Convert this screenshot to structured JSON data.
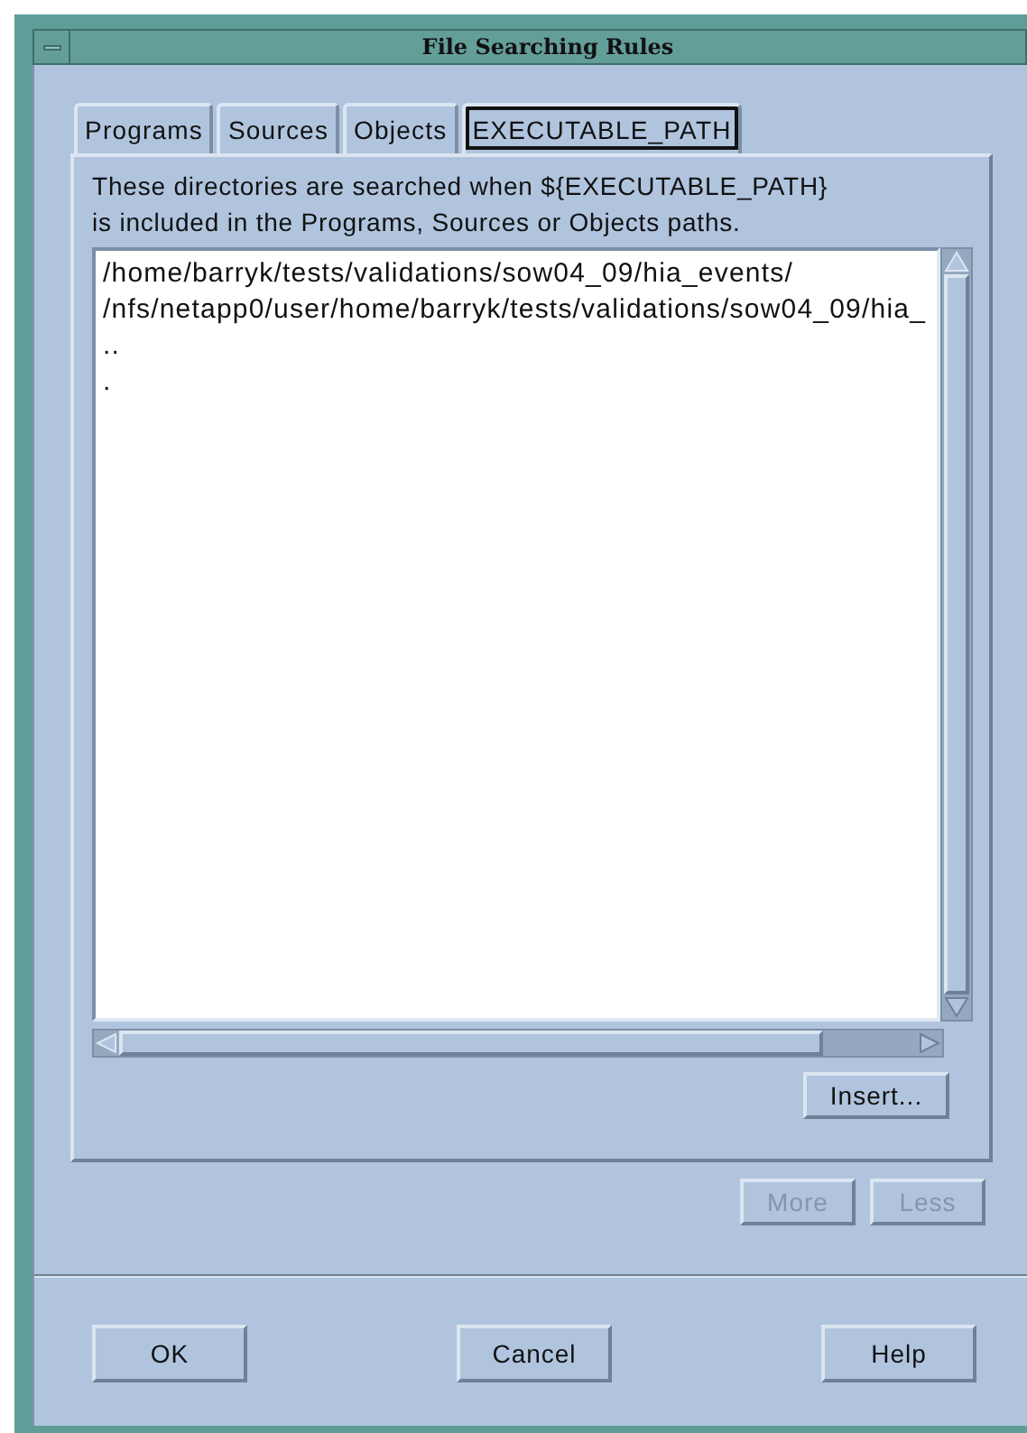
{
  "window": {
    "title": "File Searching Rules"
  },
  "tabs": [
    {
      "label": "Programs",
      "selected": false
    },
    {
      "label": "Sources",
      "selected": false
    },
    {
      "label": "Objects",
      "selected": false
    },
    {
      "label": "EXECUTABLE_PATH",
      "selected": true
    }
  ],
  "description": "These directories are searched when ${EXECUTABLE_PATH} is included in the Programs, Sources or Objects paths.",
  "paths": [
    "/home/barryk/tests/validations/sow04_09/hia_events/",
    "/nfs/netapp0/user/home/barryk/tests/validations/sow04_09/hia_",
    "..",
    "."
  ],
  "panel_buttons": [
    {
      "label": "Insert...",
      "disabled": false
    }
  ],
  "more_less": [
    {
      "label": "More",
      "disabled": true
    },
    {
      "label": "Less",
      "disabled": true
    }
  ],
  "buttons": [
    {
      "label": "OK"
    },
    {
      "label": "Cancel"
    },
    {
      "label": "Help"
    }
  ]
}
